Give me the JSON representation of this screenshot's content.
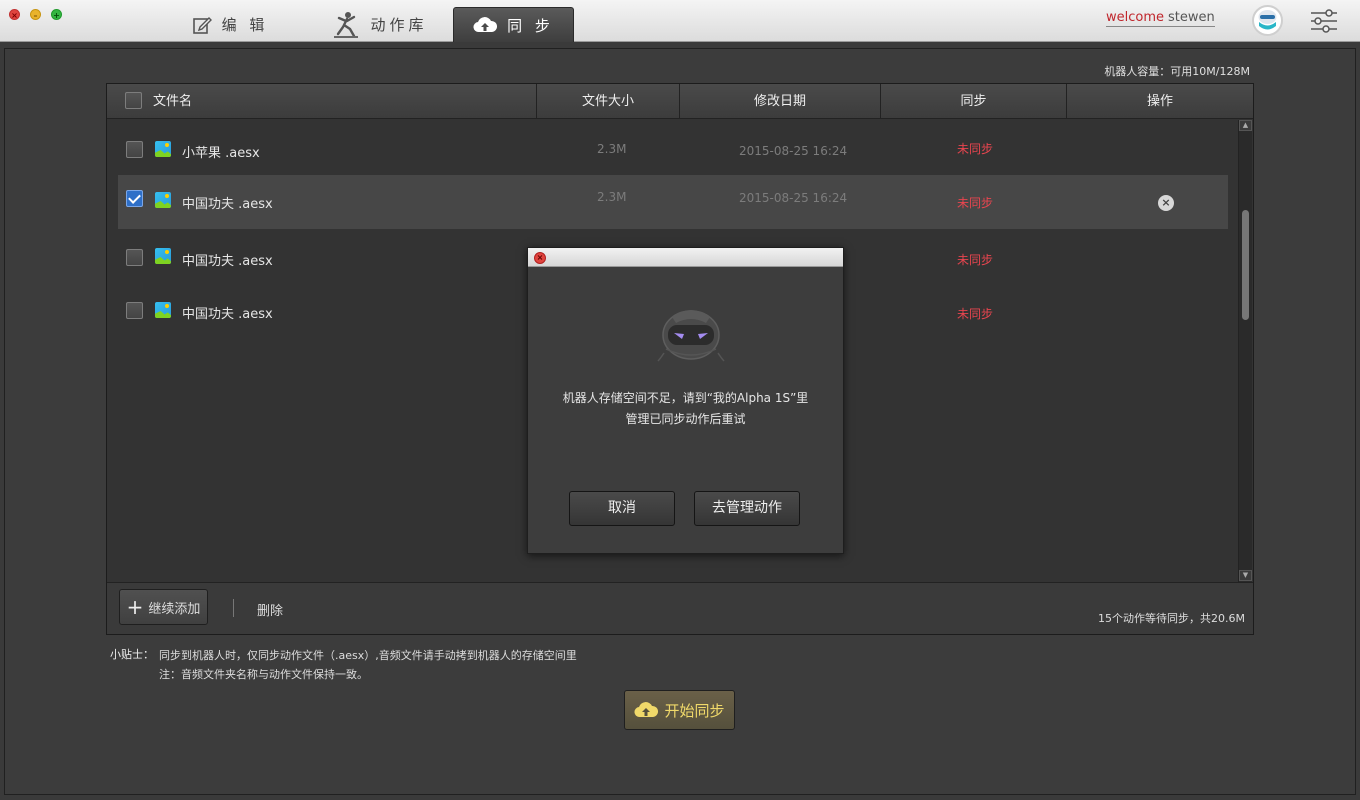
{
  "window": {
    "close_glyph": "×",
    "min_glyph": "–",
    "max_glyph": "+"
  },
  "tabs": [
    {
      "label": "编 辑",
      "icon": "edit-icon"
    },
    {
      "label": "动作库",
      "icon": "dancer-icon"
    },
    {
      "label": "同 步",
      "icon": "cloud-upload-icon",
      "active": true
    }
  ],
  "user": {
    "welcome": "welcome",
    "name": "stewen"
  },
  "capacity": "机器人容量：可用10M/128M",
  "table": {
    "headers": {
      "name": "文件名",
      "size": "文件大小",
      "date": "修改日期",
      "sync": "同步",
      "action": "操作"
    },
    "rows": [
      {
        "name": "小苹果 .aesx",
        "size": "2.3M",
        "date": "2015-08-25  16:24",
        "sync": "未同步",
        "checked": false
      },
      {
        "name": "中国功夫 .aesx",
        "size": "2.3M",
        "date": "2015-08-25  16:24",
        "sync": "未同步",
        "checked": true,
        "delete_glyph": "×"
      },
      {
        "name": "中国功夫 .aesx",
        "size": "",
        "date": "",
        "sync": "未同步",
        "checked": false
      },
      {
        "name": "中国功夫 .aesx",
        "size": "",
        "date": "",
        "sync": "未同步",
        "checked": false
      }
    ],
    "scroll_up": "▲",
    "scroll_down": "▼"
  },
  "footer": {
    "add_plus": "+",
    "add_label": "继续添加",
    "delete_label": "删除",
    "waiting": "15个动作等待同步，共20.6M"
  },
  "tips": {
    "label": "小贴士：",
    "line1": "同步到机器人时，仅同步动作文件（.aesx）,音频文件请手动拷到机器人的存储空间里",
    "line2": "注：音频文件夹名称与动作文件保持一致。"
  },
  "start_sync": "开始同步",
  "dialog": {
    "close_glyph": "×",
    "message_line1": "机器人存储空间不足，请到“我的Alpha 1S”里",
    "message_line2": "管理已同步动作后重试",
    "cancel": "取消",
    "manage": "去管理动作"
  },
  "colors": {
    "unsynced": "#e8454f",
    "welcome": "#c0262c",
    "start_text": "#f0d96a",
    "checked": "#2e6fc8"
  }
}
